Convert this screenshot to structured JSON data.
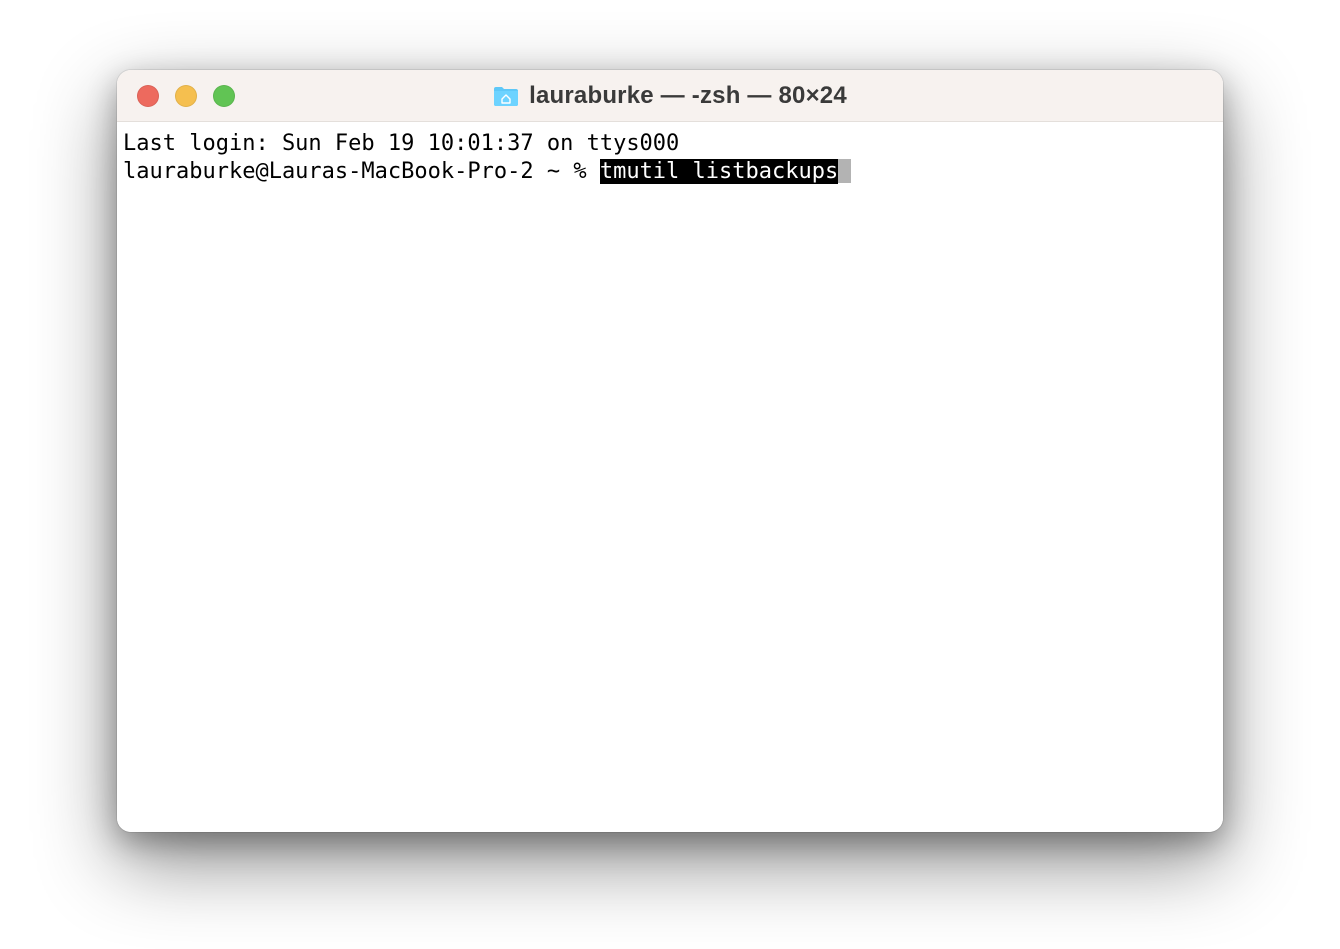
{
  "titlebar": {
    "title": "lauraburke — -zsh — 80×24"
  },
  "terminal": {
    "last_login_line": "Last login: Sun Feb 19 10:01:37 on ttys000",
    "prompt": "lauraburke@Lauras-MacBook-Pro-2 ~ % ",
    "command": "tmutil listbackups"
  }
}
